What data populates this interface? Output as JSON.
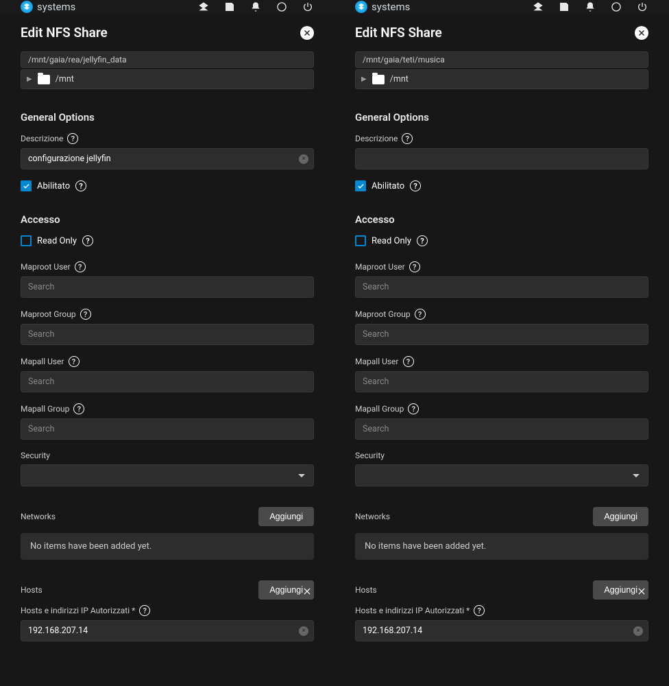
{
  "brand": "systems",
  "topbar_icons": [
    "layers-icon",
    "save-icon",
    "bell-icon",
    "status-icon",
    "power-icon"
  ],
  "left": {
    "title": "Edit NFS Share",
    "path": "/mnt/gaia/rea/jellyfin_data",
    "tree_root": "/mnt",
    "sec_general": "General Options",
    "label_desc": "Descrizione",
    "desc_value": "configurazione jellyfin",
    "label_enabled": "Abilitato",
    "enabled": true,
    "sec_access": "Accesso",
    "label_readonly": "Read Only",
    "readonly": false,
    "label_maproot_user": "Maproot User",
    "label_maproot_group": "Maproot Group",
    "label_mapall_user": "Mapall User",
    "label_mapall_group": "Mapall Group",
    "ph_search": "Search",
    "label_security": "Security",
    "label_networks": "Networks",
    "btn_add": "Aggiungi",
    "empty_msg": "No items have been added yet.",
    "label_hosts": "Hosts",
    "label_hosts_auth": "Hosts e indirizzi IP Autorizzati *",
    "host_value": "192.168.207.14"
  },
  "right": {
    "title": "Edit NFS Share",
    "path": "/mnt/gaia/teti/musica",
    "tree_root": "/mnt",
    "sec_general": "General Options",
    "label_desc": "Descrizione",
    "desc_value": "",
    "label_enabled": "Abilitato",
    "enabled": true,
    "sec_access": "Accesso",
    "label_readonly": "Read Only",
    "readonly": false,
    "label_maproot_user": "Maproot User",
    "label_maproot_group": "Maproot Group",
    "label_mapall_user": "Mapall User",
    "label_mapall_group": "Mapall Group",
    "ph_search": "Search",
    "label_security": "Security",
    "label_networks": "Networks",
    "btn_add": "Aggiungi",
    "empty_msg": "No items have been added yet.",
    "label_hosts": "Hosts",
    "label_hosts_auth": "Hosts e indirizzi IP Autorizzati *",
    "host_value": "192.168.207.14"
  }
}
